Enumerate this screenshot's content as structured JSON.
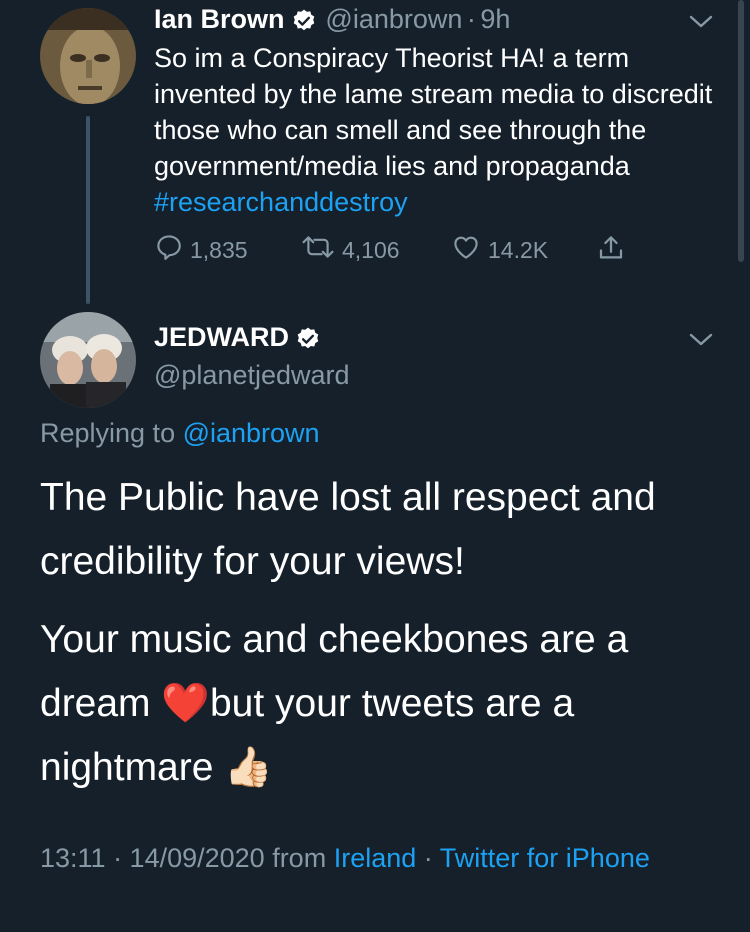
{
  "tweet1": {
    "name": "Ian Brown",
    "handle": "@ianbrown",
    "separator": "·",
    "age": "9h",
    "text_main": "So im a Conspiracy Theorist HA! a term invented by the lame stream media to discredit those who can smell and see through the government/media lies and propaganda ",
    "hashtag": "#researchanddestroy",
    "reply_count": "1,835",
    "retweet_count": "4,106",
    "like_count": "14.2K"
  },
  "tweet2": {
    "name": "JEDWARD",
    "handle": "@planetjedward",
    "replying_prefix": "Replying to ",
    "replying_handle": "@ianbrown",
    "line1": "The Public have lost all respect and",
    "line2": "credibility for your views!",
    "line3": "Your music and cheekbones are a",
    "line4_a": "dream ",
    "line4_emoji": "❤️",
    "line4_b": "but your tweets are a",
    "line5": "nightmare ",
    "line5_emoji": "👍🏻",
    "meta_time": "13:11 · 14/09/2020 from ",
    "meta_location": "Ireland",
    "meta_sep": " · ",
    "meta_client": "Twitter for iPhone"
  },
  "colors": {
    "background": "#15202b",
    "secondary_text": "#8899a6",
    "link": "#1da1f2",
    "verified_badge": "#ffffff",
    "heart": "#e0245e"
  },
  "icons": {
    "verified": "verified-badge-icon",
    "chevron": "chevron-down-icon",
    "reply": "reply-icon",
    "retweet": "retweet-icon",
    "like": "heart-icon",
    "share": "share-icon"
  }
}
